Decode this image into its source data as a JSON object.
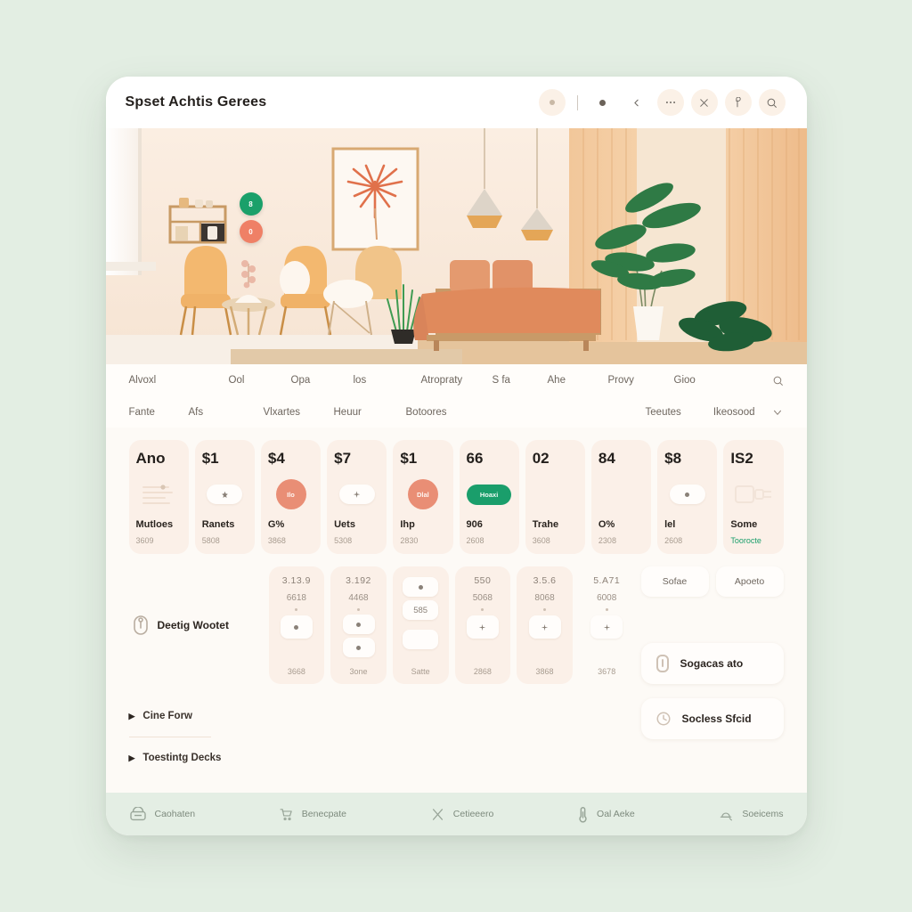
{
  "window": {
    "title": "Spset Achtis Gerees"
  },
  "toolbar": {
    "items": [
      {
        "name": "status-dot-button",
        "icon": "dot-circle-icon",
        "label": ""
      },
      {
        "name": "toolbar-divider",
        "icon": "divider-icon",
        "label": ""
      },
      {
        "name": "marker-dot-button",
        "icon": "dot-icon",
        "label": ""
      },
      {
        "name": "back-button",
        "icon": "chevron-left-icon",
        "label": ""
      },
      {
        "name": "more-options-button",
        "icon": "ellipsis-icon",
        "label": ""
      },
      {
        "name": "close-button",
        "icon": "close-icon",
        "label": ""
      },
      {
        "name": "tag-button",
        "icon": "tag-icon",
        "label": ""
      },
      {
        "name": "search-button",
        "icon": "search-icon",
        "label": ""
      }
    ]
  },
  "hero": {
    "alt": "interior-room-photo",
    "badges": [
      {
        "label": "8",
        "color": "#1aa06a"
      },
      {
        "label": "0",
        "color": "#ef8066"
      }
    ]
  },
  "nav": {
    "row1": [
      "Alvoxl",
      "Ool",
      "Opa",
      "los",
      "Atropraty",
      "S fa",
      "Ahe",
      "Provy",
      "Gioo"
    ],
    "row1_icon": "search-icon",
    "row2_left": [
      "Fante",
      "Afs",
      "Vlxartes",
      "Heuur",
      "Botoores"
    ],
    "row2_right": [
      "Teeutes",
      "Ikeosood"
    ],
    "row2_icon": "chevron-down-icon"
  },
  "cards": [
    {
      "num": "Ano",
      "icon": "document-lines-icon",
      "badge": "",
      "badge_type": "ghost",
      "label": "Mutloes",
      "sub": "3609"
    },
    {
      "num": "$1",
      "icon": "star-icon",
      "badge": "",
      "badge_type": "chip",
      "label": "Ranets",
      "sub": "5808"
    },
    {
      "num": "$4",
      "icon": "circle-badge-icon",
      "badge": "Ilo",
      "badge_type": "circle",
      "label": "G%",
      "sub": "3868"
    },
    {
      "num": "$7",
      "icon": "sparkle-icon",
      "badge": "",
      "badge_type": "chip",
      "label": "Uets",
      "sub": "5308"
    },
    {
      "num": "$1",
      "icon": "circle-badge-icon",
      "badge": "Dlal",
      "badge_type": "circle",
      "label": "Ihp",
      "sub": "2830"
    },
    {
      "num": "66",
      "icon": "pill-badge-icon",
      "badge": "Hoaxi",
      "badge_type": "pill",
      "label": "906",
      "sub": "2608"
    },
    {
      "num": "02",
      "icon": "none-icon",
      "badge": "",
      "badge_type": "none",
      "label": "Trahe",
      "sub": "3608"
    },
    {
      "num": "84",
      "icon": "none-icon",
      "badge": "",
      "badge_type": "none",
      "label": "O%",
      "sub": "2308"
    },
    {
      "num": "$8",
      "icon": "dot-chip-icon",
      "badge": "",
      "badge_type": "chip",
      "label": "lel",
      "sub": "2608"
    },
    {
      "num": "IS2",
      "icon": "plug-device-icon",
      "badge": "",
      "badge_type": "ghost",
      "label": "Some",
      "sub": "Toorocte",
      "sub_green": true
    }
  ],
  "tiles_section": {
    "left_icon": "sensor-icon",
    "left_label": "Deetig Wootet",
    "tiles": [
      {
        "num": "3.13.9",
        "val": "6618",
        "btn_icon": "dot-icon",
        "variant": "single",
        "foot": "3668"
      },
      {
        "num": "3.192",
        "val": "4468",
        "btn_icon": "dot-icon",
        "variant": "double",
        "foot": "3one"
      },
      {
        "num": "",
        "val": "585",
        "btn_icon": "dot-icon",
        "variant": "stack",
        "foot": "Satte"
      },
      {
        "num": "550",
        "val": "5068",
        "btn_icon": "plus-icon",
        "variant": "single",
        "foot": "2868"
      },
      {
        "num": "3.5.6",
        "val": "8068",
        "btn_icon": "plus-icon",
        "variant": "single",
        "foot": "3868"
      },
      {
        "num": "5.A71",
        "val": "6008",
        "btn_icon": "plus-icon",
        "variant": "plain",
        "foot": "3678"
      }
    ]
  },
  "rail": {
    "buttons": [
      {
        "label": "Sofae"
      },
      {
        "label": "Apoeto"
      }
    ],
    "wide_button": {
      "label": "Sogacas ato",
      "icon": "battery-icon"
    },
    "lower_button": {
      "label": "Socless Sfcid",
      "icon": "clock-icon"
    }
  },
  "accordion": [
    {
      "label": "Cine Forw",
      "icon": "caret-right-icon"
    },
    {
      "label": "Toestintg Decks",
      "icon": "caret-right-icon"
    }
  ],
  "footer": {
    "items": [
      {
        "label": "Caohaten",
        "icon": "archive-icon"
      },
      {
        "label": "Benecpate",
        "icon": "cart-icon"
      },
      {
        "label": "Cetieeero",
        "icon": "close-icon"
      },
      {
        "label": "Oal Aeke",
        "icon": "thermometer-icon"
      },
      {
        "label": "Soeicems",
        "icon": "bell-icon"
      }
    ]
  },
  "colors": {
    "page_bg": "#e3eee3",
    "window_bg": "#fdfaf6",
    "card_bg": "#fbf0e8",
    "accent_green": "#1a9e6b",
    "accent_coral": "#e98e75",
    "footer_bg": "#e4eee4"
  }
}
